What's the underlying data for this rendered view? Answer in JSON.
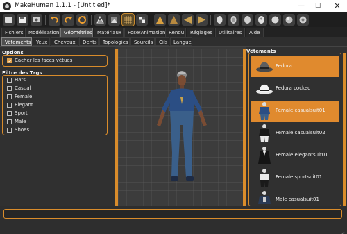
{
  "window": {
    "title": "MakeHuman 1.1.1 - [Untitled]*"
  },
  "toolbar": {
    "icons": [
      "folder-icon",
      "save-icon",
      "export-icon",
      "undo-icon",
      "redo-icon",
      "reset-icon",
      "wireframe-icon",
      "grid-icon",
      "checker-icon",
      "front-view-icon",
      "back-view-icon",
      "left-view-icon",
      "right-view-icon",
      "top-view-icon",
      "bottom-view-icon",
      "camera-reset-icon",
      "smooth-icon",
      "settings-icon"
    ]
  },
  "tabs": [
    "Fichiers",
    "Modélisation",
    "Géométries",
    "Matériaux",
    "Pose/Animation",
    "Rendu",
    "Réglages",
    "Utilitaires",
    "Aide"
  ],
  "active_tab": "Géométries",
  "subtabs": [
    "Vêtements",
    "Yeux",
    "Cheveux",
    "Dents",
    "Topologies",
    "Sourcils",
    "Cils",
    "Langue"
  ],
  "active_subtab": "Vêtements",
  "left": {
    "options_title": "Options",
    "hide_faces_label": "Cacher les faces vêtues",
    "hide_faces_checked": true,
    "tags_title": "Filtre des Tags",
    "tags": [
      "Hats",
      "Casual",
      "Female",
      "Elegant",
      "Sport",
      "Male",
      "Shoes"
    ]
  },
  "right": {
    "title": "Vêtements",
    "items": [
      {
        "name": "Fedora",
        "selected": true,
        "thumb": "hat"
      },
      {
        "name": "Fedora cocked",
        "selected": false,
        "thumb": "hat-white"
      },
      {
        "name": "Female casualsuit01",
        "selected": true,
        "thumb": "suit-blue"
      },
      {
        "name": "Female casualsuit02",
        "selected": false,
        "thumb": "suit-dark"
      },
      {
        "name": "Female elegantsuit01",
        "selected": false,
        "thumb": "suit-dark"
      },
      {
        "name": "Female sportsuit01",
        "selected": false,
        "thumb": "suit-dark"
      },
      {
        "name": "Male casualsuit01",
        "selected": false,
        "thumb": "suit-dark"
      }
    ]
  },
  "colors": {
    "accent": "#d98c2b",
    "selected": "#e08a2e",
    "panel": "#303030",
    "viewport": "#3c3c3c"
  }
}
